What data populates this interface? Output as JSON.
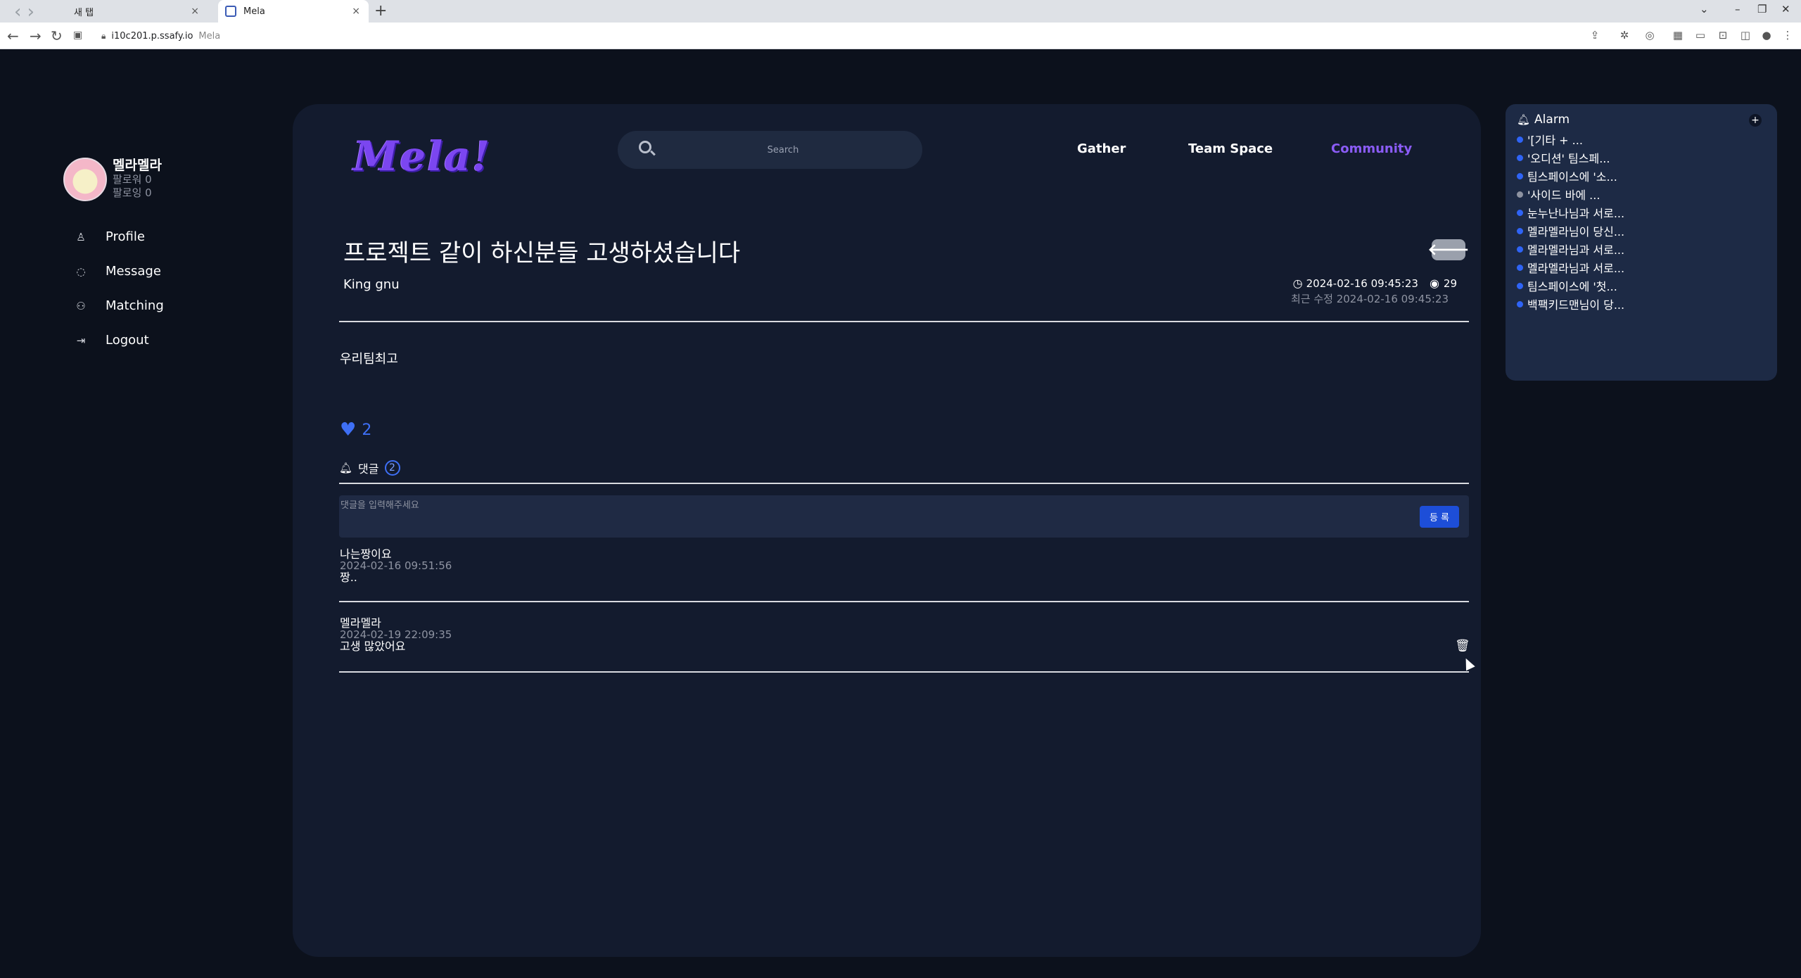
{
  "browser": {
    "inactive_tab": "새 탭",
    "active_tab": "Mela",
    "new_tab": "+",
    "url": "i10c201.p.ssafy.io",
    "url_title": "Mela"
  },
  "sidebar": {
    "user_name": "멜라멜라",
    "followers": "팔로워 0",
    "following": "팔로잉 0",
    "menu": [
      {
        "label": "Profile",
        "icon": "user-icon"
      },
      {
        "label": "Message",
        "icon": "message-icon"
      },
      {
        "label": "Matching",
        "icon": "matching-icon"
      },
      {
        "label": "Logout",
        "icon": "logout-icon"
      }
    ]
  },
  "header": {
    "logo": "Mela!",
    "search_placeholder": "Search",
    "nav": [
      "Gather",
      "Team Space",
      "Community"
    ],
    "active_nav": "Community"
  },
  "post": {
    "title": "프로젝트 같이 하신분들 고생하셨습니다",
    "author": "King gnu",
    "created": "2024-02-16 09:45:23",
    "views": "29",
    "modified": "최근 수정 2024-02-16 09:45:23",
    "content": "우리팀최고",
    "likes": "2"
  },
  "comments": {
    "label": "댓글",
    "count": "2",
    "placeholder": "댓글을 입력해주세요",
    "submit": "등 록",
    "items": [
      {
        "author": "나는짱이요",
        "date": "2024-02-16 09:51:56",
        "text": "짱.."
      },
      {
        "author": "멜라멜라",
        "date": "2024-02-19 22:09:35",
        "text": "고생 많았어요"
      }
    ]
  },
  "alarm": {
    "title": "Alarm",
    "items": [
      {
        "text": "'[기타 + ...",
        "read": false
      },
      {
        "text": "'오디션' 팀스페...",
        "read": false
      },
      {
        "text": "팀스페이스에 '소...",
        "read": false
      },
      {
        "text": "'사이드 바에 ...",
        "read": true
      },
      {
        "text": "눈누난나님과 서로...",
        "read": false
      },
      {
        "text": "멜라멜라님이 당신...",
        "read": false
      },
      {
        "text": "멜라멜라님과 서로...",
        "read": false
      },
      {
        "text": "멜라멜라님과 서로...",
        "read": false
      },
      {
        "text": "팀스페이스에 '첫...",
        "read": false
      },
      {
        "text": "백팩키드맨님이 당...",
        "read": false
      }
    ]
  },
  "colors": {
    "background": "#0c111c",
    "panel": "#131b2e",
    "accent_purple": "#8b5cf6",
    "accent_blue": "#3e6ff5"
  }
}
